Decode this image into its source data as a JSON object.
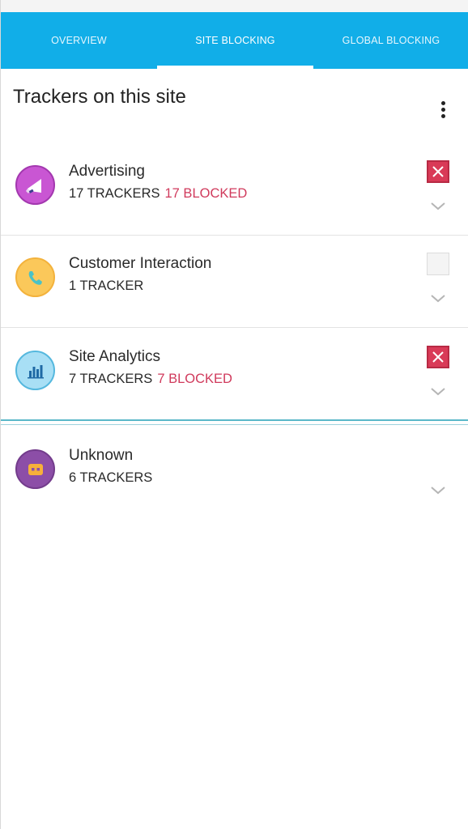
{
  "tabs": {
    "overview": "OVERVIEW",
    "site_blocking": "SITE BLOCKING",
    "global_blocking": "GLOBAL BLOCKING",
    "active": "site_blocking"
  },
  "title": "Trackers on this site",
  "colors": {
    "tabbar": "#11aee8",
    "blocked_text": "#d03a5c",
    "block_on": "#d93a57"
  },
  "categories": [
    {
      "name": "Advertising",
      "count": "17 TRACKERS",
      "blocked": "17 BLOCKED",
      "icon": "megaphone-icon",
      "blocked_state": true
    },
    {
      "name": "Customer Interaction",
      "count": "1 TRACKER",
      "blocked": "",
      "icon": "phone-icon",
      "blocked_state": false
    },
    {
      "name": "Site Analytics",
      "count": "7 TRACKERS",
      "blocked": "7 BLOCKED",
      "icon": "bar-chart-icon",
      "blocked_state": true
    },
    {
      "name": "Unknown",
      "count": "6 TRACKERS",
      "blocked": "",
      "icon": "unknown-tracker-icon",
      "blocked_state": false
    }
  ]
}
